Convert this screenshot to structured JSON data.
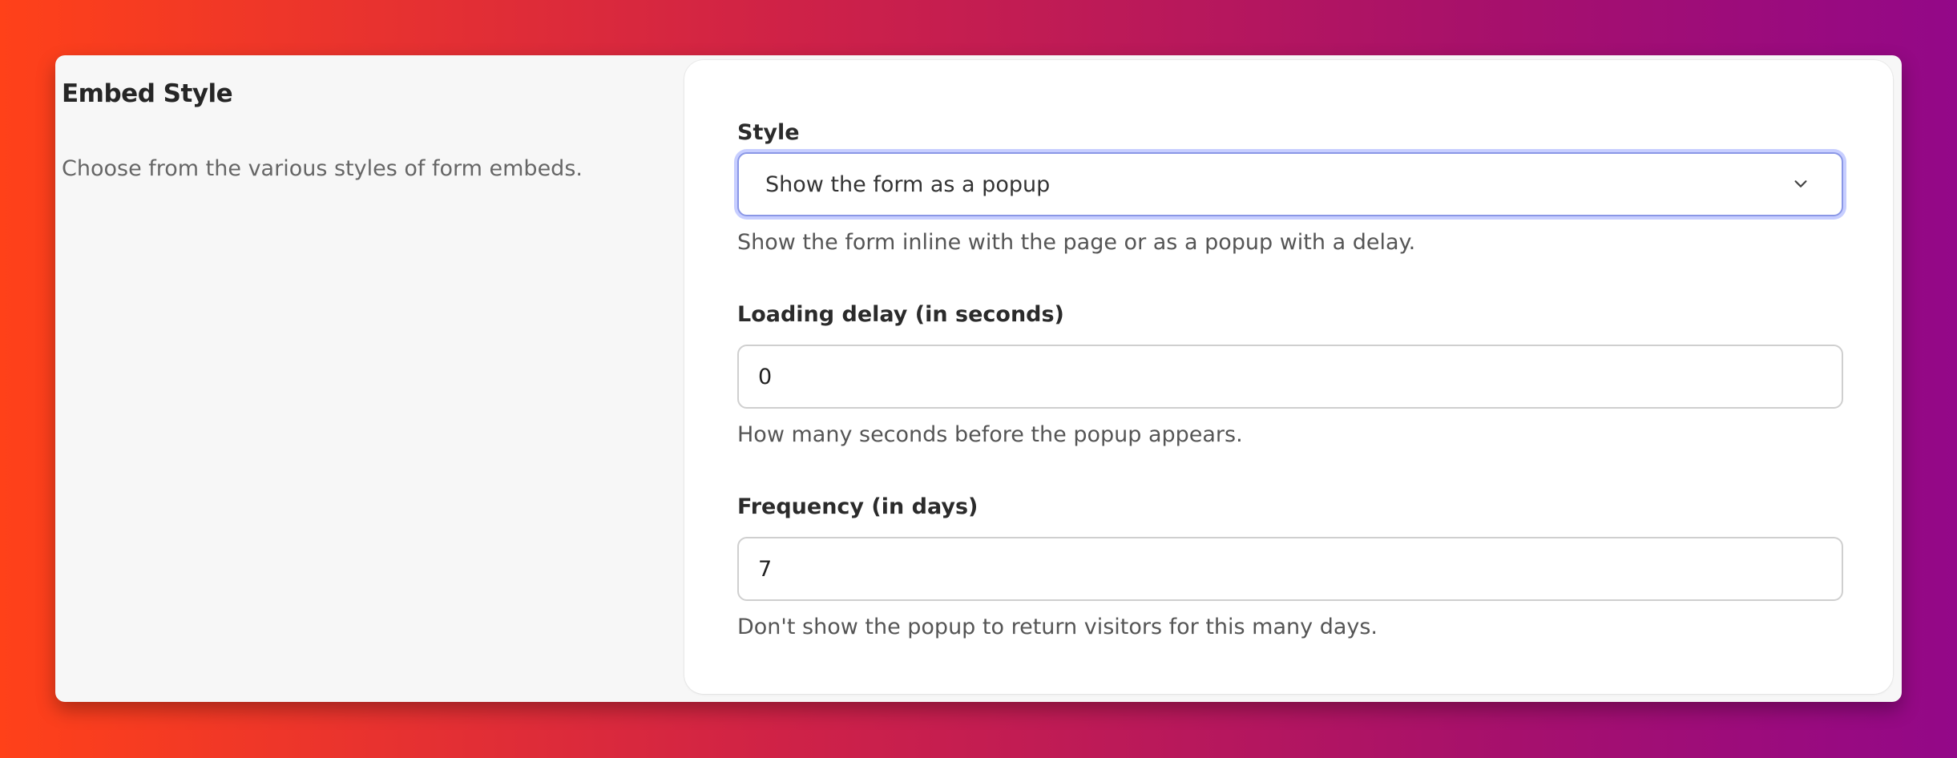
{
  "section": {
    "title": "Embed Style",
    "description": "Choose from the various styles of form embeds."
  },
  "form": {
    "style": {
      "label": "Style",
      "selected": "Show the form as a popup",
      "help": "Show the form inline with the page or as a popup with a delay."
    },
    "loading_delay": {
      "label": "Loading delay (in seconds)",
      "value": "0",
      "help": "How many seconds before the popup appears."
    },
    "frequency": {
      "label": "Frequency (in days)",
      "value": "7",
      "help": "Don't show the popup to return visitors for this many days."
    }
  },
  "icons": {
    "select_chevron": "chevron-down-icon"
  },
  "colors": {
    "focus_ring": "#c7ceff",
    "focus_border": "#8a97e6"
  }
}
